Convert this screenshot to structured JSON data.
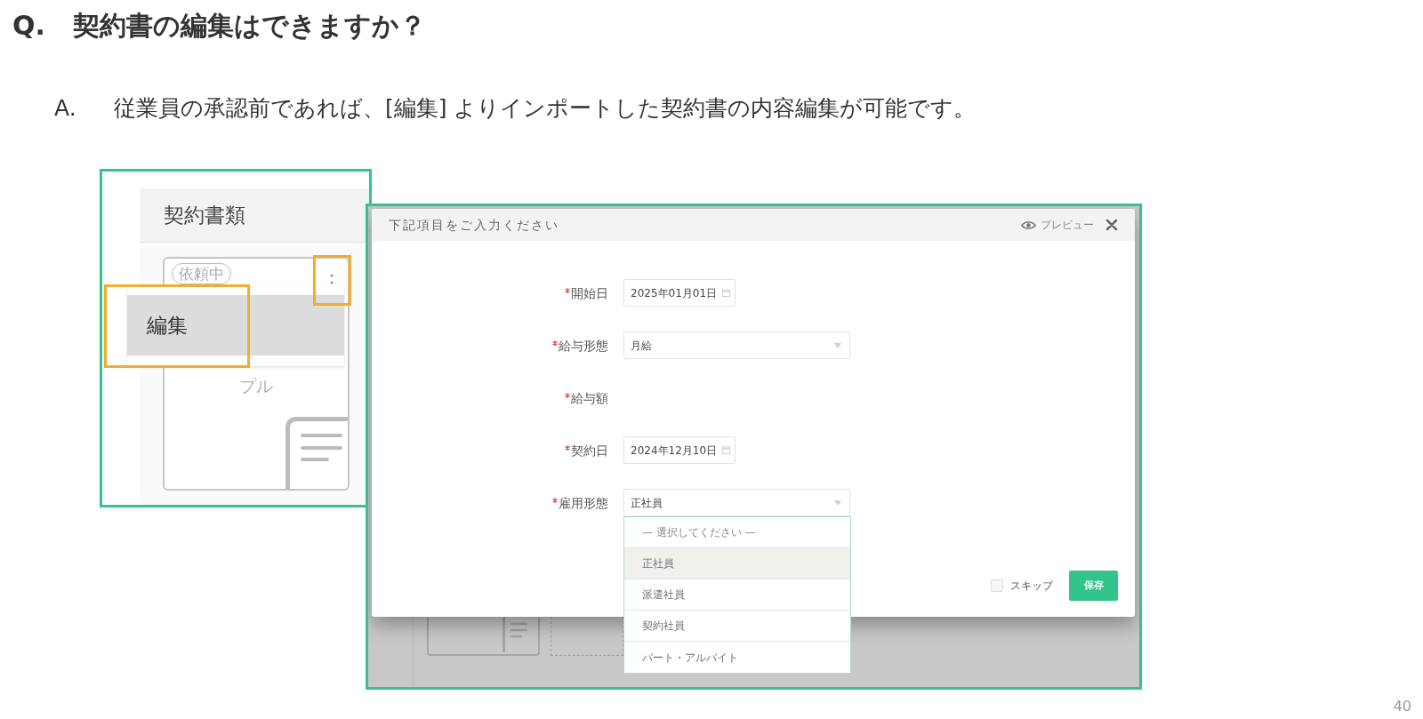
{
  "question": {
    "label": "Q.",
    "text": "契約書の編集はできますか？"
  },
  "answer": {
    "label": "A.",
    "text": "従業員の承認前であれば、[編集] よりインポートした契約書の内容編集が可能です。"
  },
  "screenshot_1": {
    "panel_title": "契約書類",
    "card": {
      "badge": "依頼中",
      "caption": "プル"
    },
    "menu": [
      {
        "label": "編集",
        "selected": true
      }
    ]
  },
  "screenshot_2": {
    "dialog": {
      "title": "下記項目をご入力ください",
      "preview": "プレビュー",
      "fields": [
        {
          "label": "開始日",
          "required": true,
          "kind": "date",
          "value": "2025年01月01日"
        },
        {
          "label": "給与形態",
          "required": true,
          "kind": "select",
          "value": "月給"
        },
        {
          "label": "給与額",
          "required": true,
          "kind": "none"
        },
        {
          "label": "契約日",
          "required": true,
          "kind": "date",
          "value": "2024年12月10日"
        },
        {
          "label": "雇用形態",
          "required": true,
          "kind": "select",
          "value": "正社員",
          "options": [
            {
              "label": "— 選択してください —",
              "kind": "placeholder",
              "selected": false
            },
            {
              "label": "正社員",
              "kind": "option",
              "selected": true
            },
            {
              "label": "派遣社員",
              "kind": "option",
              "selected": false
            },
            {
              "label": "契約社員",
              "kind": "option",
              "selected": false
            },
            {
              "label": "パート・アルバイト",
              "kind": "option",
              "selected": false
            }
          ]
        }
      ],
      "skip": {
        "label": "スキップ",
        "checked": false
      },
      "save": "保存"
    }
  },
  "page_number": "40"
}
